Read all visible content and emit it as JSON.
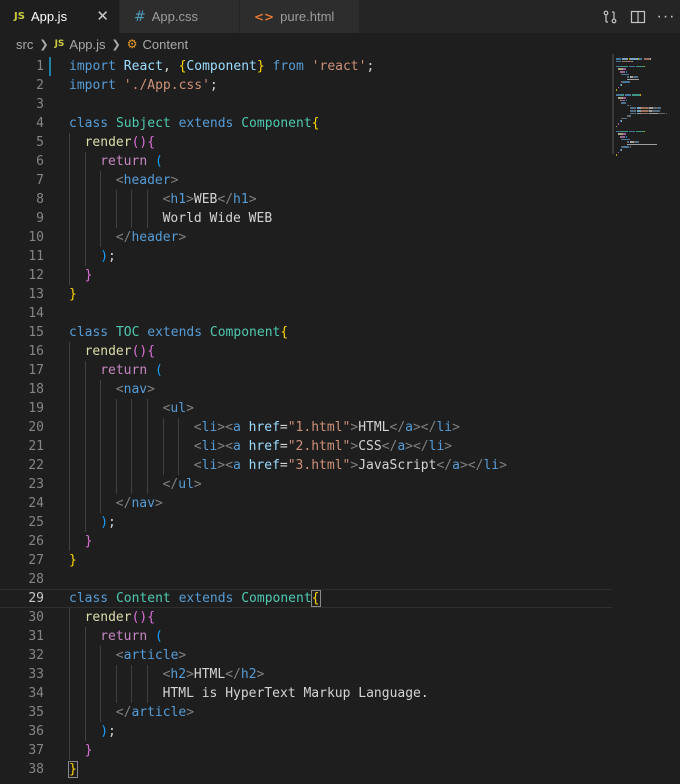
{
  "tabs": [
    {
      "icon": "JS",
      "label": "App.js",
      "close": "✕"
    },
    {
      "icon": "#",
      "label": "App.css"
    },
    {
      "icon": "<>",
      "label": "pure.html"
    }
  ],
  "breadcrumb": {
    "folder": "src",
    "file_icon": "JS",
    "file": "App.js",
    "symbol": "Content"
  },
  "colors": {
    "accent": "#1b81a8",
    "background": "#1e1e1e",
    "tabbar": "#252526"
  },
  "lines": [
    {
      "n": "1",
      "indent": 0,
      "t": [
        [
          "kw",
          "import "
        ],
        [
          "var",
          "React"
        ],
        [
          "pun",
          ", "
        ],
        [
          "bq",
          "{"
        ],
        [
          "var",
          "Component"
        ],
        [
          "bq",
          "}"
        ],
        [
          "kw",
          " from "
        ],
        [
          "str",
          "'react'"
        ],
        [
          "pun",
          ";"
        ]
      ]
    },
    {
      "n": "2",
      "indent": 0,
      "t": [
        [
          "kw",
          "import "
        ],
        [
          "str",
          "'./App.css'"
        ],
        [
          "pun",
          ";"
        ]
      ]
    },
    {
      "n": "3",
      "indent": 0,
      "t": []
    },
    {
      "n": "4",
      "indent": 0,
      "t": [
        [
          "kw",
          "class "
        ],
        [
          "cls",
          "Subject "
        ],
        [
          "kw",
          "extends "
        ],
        [
          "cls",
          "Component"
        ],
        [
          "bq",
          "{"
        ]
      ]
    },
    {
      "n": "5",
      "indent": 1,
      "t": [
        [
          "fn",
          "render"
        ],
        [
          "bp",
          "()"
        ],
        [
          "bp",
          "{"
        ]
      ]
    },
    {
      "n": "6",
      "indent": 2,
      "t": [
        [
          "ctrl",
          "return "
        ],
        [
          "bb",
          "("
        ]
      ]
    },
    {
      "n": "7",
      "indent": 3,
      "t": [
        [
          "br",
          "<"
        ],
        [
          "tag",
          "header"
        ],
        [
          "br",
          ">"
        ]
      ]
    },
    {
      "n": "8",
      "indent": 6,
      "t": [
        [
          "br",
          "<"
        ],
        [
          "tag",
          "h1"
        ],
        [
          "br",
          ">"
        ],
        [
          "pun",
          "WEB"
        ],
        [
          "br",
          "</"
        ],
        [
          "tag",
          "h1"
        ],
        [
          "br",
          ">"
        ]
      ]
    },
    {
      "n": "9",
      "indent": 6,
      "t": [
        [
          "pun",
          "World Wide WEB"
        ]
      ]
    },
    {
      "n": "10",
      "indent": 3,
      "t": [
        [
          "br",
          "</"
        ],
        [
          "tag",
          "header"
        ],
        [
          "br",
          ">"
        ]
      ]
    },
    {
      "n": "11",
      "indent": 2,
      "t": [
        [
          "bb",
          ")"
        ],
        [
          "pun",
          ";"
        ]
      ]
    },
    {
      "n": "12",
      "indent": 1,
      "t": [
        [
          "bp",
          "}"
        ]
      ]
    },
    {
      "n": "13",
      "indent": 0,
      "t": [
        [
          "bq",
          "}"
        ]
      ]
    },
    {
      "n": "14",
      "indent": 0,
      "t": []
    },
    {
      "n": "15",
      "indent": 0,
      "t": [
        [
          "kw",
          "class "
        ],
        [
          "cls",
          "TOC "
        ],
        [
          "kw",
          "extends "
        ],
        [
          "cls",
          "Component"
        ],
        [
          "bq",
          "{"
        ]
      ]
    },
    {
      "n": "16",
      "indent": 1,
      "t": [
        [
          "fn",
          "render"
        ],
        [
          "bp",
          "()"
        ],
        [
          "bp",
          "{"
        ]
      ]
    },
    {
      "n": "17",
      "indent": 2,
      "t": [
        [
          "ctrl",
          "return "
        ],
        [
          "bb",
          "("
        ]
      ]
    },
    {
      "n": "18",
      "indent": 3,
      "t": [
        [
          "br",
          "<"
        ],
        [
          "tag",
          "nav"
        ],
        [
          "br",
          ">"
        ]
      ]
    },
    {
      "n": "19",
      "indent": 6,
      "t": [
        [
          "br",
          "<"
        ],
        [
          "tag",
          "ul"
        ],
        [
          "br",
          ">"
        ]
      ]
    },
    {
      "n": "20",
      "indent": 8,
      "t": [
        [
          "br",
          "<"
        ],
        [
          "tag",
          "li"
        ],
        [
          "br",
          "><"
        ],
        [
          "tag",
          "a "
        ],
        [
          "attr",
          "href"
        ],
        [
          "pun",
          "="
        ],
        [
          "str",
          "\"1.html\""
        ],
        [
          "br",
          ">"
        ],
        [
          "pun",
          "HTML"
        ],
        [
          "br",
          "</"
        ],
        [
          "tag",
          "a"
        ],
        [
          "br",
          "></"
        ],
        [
          "tag",
          "li"
        ],
        [
          "br",
          ">"
        ]
      ]
    },
    {
      "n": "21",
      "indent": 8,
      "t": [
        [
          "br",
          "<"
        ],
        [
          "tag",
          "li"
        ],
        [
          "br",
          "><"
        ],
        [
          "tag",
          "a "
        ],
        [
          "attr",
          "href"
        ],
        [
          "pun",
          "="
        ],
        [
          "str",
          "\"2.html\""
        ],
        [
          "br",
          ">"
        ],
        [
          "pun",
          "CSS"
        ],
        [
          "br",
          "</"
        ],
        [
          "tag",
          "a"
        ],
        [
          "br",
          "></"
        ],
        [
          "tag",
          "li"
        ],
        [
          "br",
          ">"
        ]
      ]
    },
    {
      "n": "22",
      "indent": 8,
      "t": [
        [
          "br",
          "<"
        ],
        [
          "tag",
          "li"
        ],
        [
          "br",
          "><"
        ],
        [
          "tag",
          "a "
        ],
        [
          "attr",
          "href"
        ],
        [
          "pun",
          "="
        ],
        [
          "str",
          "\"3.html\""
        ],
        [
          "br",
          ">"
        ],
        [
          "pun",
          "JavaScript"
        ],
        [
          "br",
          "</"
        ],
        [
          "tag",
          "a"
        ],
        [
          "br",
          "></"
        ],
        [
          "tag",
          "li"
        ],
        [
          "br",
          ">"
        ]
      ]
    },
    {
      "n": "23",
      "indent": 6,
      "t": [
        [
          "br",
          "</"
        ],
        [
          "tag",
          "ul"
        ],
        [
          "br",
          ">"
        ]
      ]
    },
    {
      "n": "24",
      "indent": 3,
      "t": [
        [
          "br",
          "</"
        ],
        [
          "tag",
          "nav"
        ],
        [
          "br",
          ">"
        ]
      ]
    },
    {
      "n": "25",
      "indent": 2,
      "t": [
        [
          "bb",
          ")"
        ],
        [
          "pun",
          ";"
        ]
      ]
    },
    {
      "n": "26",
      "indent": 1,
      "t": [
        [
          "bp",
          "}"
        ]
      ]
    },
    {
      "n": "27",
      "indent": 0,
      "t": [
        [
          "bq",
          "}"
        ]
      ]
    },
    {
      "n": "28",
      "indent": 0,
      "t": []
    },
    {
      "n": "29",
      "indent": 0,
      "current": true,
      "t": [
        [
          "kw",
          "class "
        ],
        [
          "cls",
          "Content "
        ],
        [
          "kw",
          "extends "
        ],
        [
          "cls",
          "Component"
        ],
        [
          "bqm",
          "{"
        ]
      ]
    },
    {
      "n": "30",
      "indent": 1,
      "t": [
        [
          "fn",
          "render"
        ],
        [
          "bp",
          "()"
        ],
        [
          "bp",
          "{"
        ]
      ]
    },
    {
      "n": "31",
      "indent": 2,
      "t": [
        [
          "ctrl",
          "return "
        ],
        [
          "bb",
          "("
        ]
      ]
    },
    {
      "n": "32",
      "indent": 3,
      "t": [
        [
          "br",
          "<"
        ],
        [
          "tag",
          "article"
        ],
        [
          "br",
          ">"
        ]
      ]
    },
    {
      "n": "33",
      "indent": 6,
      "t": [
        [
          "br",
          "<"
        ],
        [
          "tag",
          "h2"
        ],
        [
          "br",
          ">"
        ],
        [
          "pun",
          "HTML"
        ],
        [
          "br",
          "</"
        ],
        [
          "tag",
          "h2"
        ],
        [
          "br",
          ">"
        ]
      ]
    },
    {
      "n": "34",
      "indent": 6,
      "t": [
        [
          "pun",
          "HTML is HyperText Markup Language."
        ]
      ]
    },
    {
      "n": "35",
      "indent": 3,
      "t": [
        [
          "br",
          "</"
        ],
        [
          "tag",
          "article"
        ],
        [
          "br",
          ">"
        ]
      ]
    },
    {
      "n": "36",
      "indent": 2,
      "t": [
        [
          "bb",
          ")"
        ],
        [
          "pun",
          ";"
        ]
      ]
    },
    {
      "n": "37",
      "indent": 1,
      "t": [
        [
          "bp",
          "}"
        ]
      ]
    },
    {
      "n": "38",
      "indent": 0,
      "t": [
        [
          "bqm",
          "}"
        ]
      ]
    }
  ]
}
